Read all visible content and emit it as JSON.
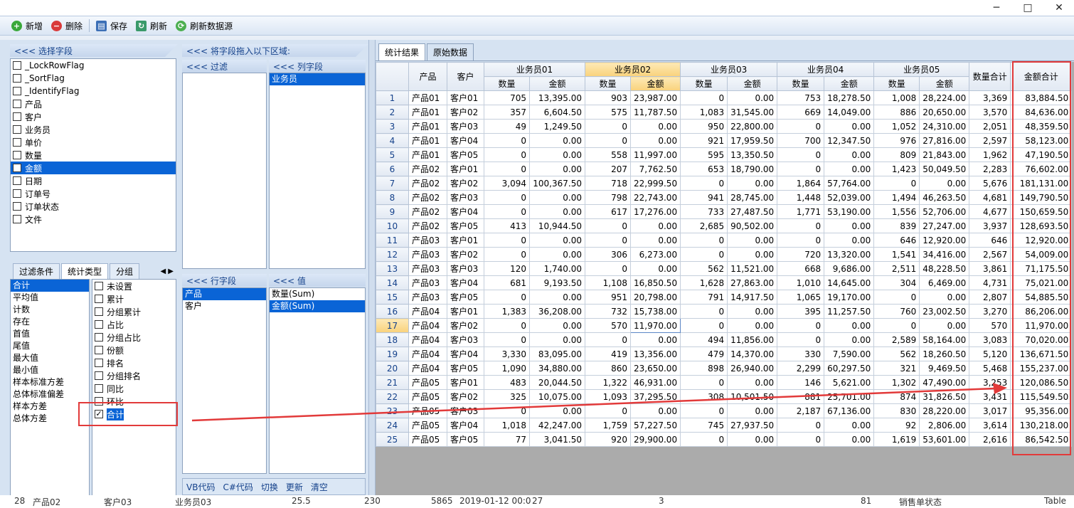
{
  "window": {
    "minimize": "─",
    "maximize": "□",
    "close": "✕"
  },
  "toolbar": {
    "add": "新增",
    "delete": "删除",
    "save": "保存",
    "refresh": "刷新",
    "refresh_source": "刷新数据源"
  },
  "left": {
    "select_field_header": "<<< 选择字段",
    "drag_header": "<<< 将字段拖入以下区域:",
    "filter_header": "<<< 过滤",
    "column_header": "<<< 列字段",
    "row_header": "<<< 行字段",
    "value_header": "<<< 值",
    "fields": [
      "_LockRowFlag",
      "_SortFlag",
      "_IdentifyFlag",
      "产品",
      "客户",
      "业务员",
      "单价",
      "数量",
      "金额",
      "日期",
      "订单号",
      "订单状态",
      "文件"
    ],
    "selected_field": "金额",
    "column_fields": [
      "业务员"
    ],
    "row_fields": [
      "产品",
      "客户"
    ],
    "value_fields": [
      "数量(Sum)",
      "金额(Sum)"
    ],
    "tabs": [
      "过滤条件",
      "统计类型",
      "分组"
    ],
    "tab_arrows": "◀ ▶",
    "stat_types": [
      "合计",
      "平均值",
      "计数",
      "存在",
      "首值",
      "尾值",
      "最大值",
      "最小值",
      "样本标准方差",
      "总体标准偏差",
      "样本方差",
      "总体方差"
    ],
    "options": [
      "未设置",
      "累计",
      "分组累计",
      "占比",
      "分组占比",
      "份额",
      "排名",
      "分组排名",
      "同比",
      "环比",
      "合计"
    ],
    "option_checked": "合计",
    "code_buttons": [
      "VB代码",
      "C#代码",
      "切换",
      "更新",
      "清空"
    ]
  },
  "right": {
    "tabs": [
      "统计结果",
      "原始数据"
    ],
    "header": {
      "product": "产品",
      "customer": "客户",
      "reps": [
        "业务员01",
        "业务员02",
        "业务员03",
        "业务员04",
        "业务员05"
      ],
      "qty": "数量",
      "amt": "金额",
      "qty_total": "数量合计",
      "amt_total": "金额合计"
    },
    "rows": [
      [
        "1",
        "产品01",
        "客户01",
        "705",
        "13,395.00",
        "903",
        "23,987.00",
        "0",
        "0.00",
        "753",
        "18,278.50",
        "1,008",
        "28,224.00",
        "3,369",
        "83,884.50"
      ],
      [
        "2",
        "产品01",
        "客户02",
        "357",
        "6,604.50",
        "575",
        "11,787.50",
        "1,083",
        "31,545.00",
        "669",
        "14,049.00",
        "886",
        "20,650.00",
        "3,570",
        "84,636.00"
      ],
      [
        "3",
        "产品01",
        "客户03",
        "49",
        "1,249.50",
        "0",
        "0.00",
        "950",
        "22,800.00",
        "0",
        "0.00",
        "1,052",
        "24,310.00",
        "2,051",
        "48,359.50"
      ],
      [
        "4",
        "产品01",
        "客户04",
        "0",
        "0.00",
        "0",
        "0.00",
        "921",
        "17,959.50",
        "700",
        "12,347.50",
        "976",
        "27,816.00",
        "2,597",
        "58,123.00"
      ],
      [
        "5",
        "产品01",
        "客户05",
        "0",
        "0.00",
        "558",
        "11,997.00",
        "595",
        "13,350.50",
        "0",
        "0.00",
        "809",
        "21,843.00",
        "1,962",
        "47,190.50"
      ],
      [
        "6",
        "产品02",
        "客户01",
        "0",
        "0.00",
        "207",
        "7,762.50",
        "653",
        "18,790.00",
        "0",
        "0.00",
        "1,423",
        "50,049.50",
        "2,283",
        "76,602.00"
      ],
      [
        "7",
        "产品02",
        "客户02",
        "3,094",
        "100,367.50",
        "718",
        "22,999.50",
        "0",
        "0.00",
        "1,864",
        "57,764.00",
        "0",
        "0.00",
        "5,676",
        "181,131.00"
      ],
      [
        "8",
        "产品02",
        "客户03",
        "0",
        "0.00",
        "798",
        "22,743.00",
        "941",
        "28,745.00",
        "1,448",
        "52,039.00",
        "1,494",
        "46,263.50",
        "4,681",
        "149,790.50"
      ],
      [
        "9",
        "产品02",
        "客户04",
        "0",
        "0.00",
        "617",
        "17,276.00",
        "733",
        "27,487.50",
        "1,771",
        "53,190.00",
        "1,556",
        "52,706.00",
        "4,677",
        "150,659.50"
      ],
      [
        "10",
        "产品02",
        "客户05",
        "413",
        "10,944.50",
        "0",
        "0.00",
        "2,685",
        "90,502.00",
        "0",
        "0.00",
        "839",
        "27,247.00",
        "3,937",
        "128,693.50"
      ],
      [
        "11",
        "产品03",
        "客户01",
        "0",
        "0.00",
        "0",
        "0.00",
        "0",
        "0.00",
        "0",
        "0.00",
        "646",
        "12,920.00",
        "646",
        "12,920.00"
      ],
      [
        "12",
        "产品03",
        "客户02",
        "0",
        "0.00",
        "306",
        "6,273.00",
        "0",
        "0.00",
        "720",
        "13,320.00",
        "1,541",
        "34,416.00",
        "2,567",
        "54,009.00"
      ],
      [
        "13",
        "产品03",
        "客户03",
        "120",
        "1,740.00",
        "0",
        "0.00",
        "562",
        "11,521.00",
        "668",
        "9,686.00",
        "2,511",
        "48,228.50",
        "3,861",
        "71,175.50"
      ],
      [
        "14",
        "产品03",
        "客户04",
        "681",
        "9,193.50",
        "1,108",
        "16,850.50",
        "1,628",
        "27,863.00",
        "1,010",
        "14,645.00",
        "304",
        "6,469.00",
        "4,731",
        "75,021.00"
      ],
      [
        "15",
        "产品03",
        "客户05",
        "0",
        "0.00",
        "951",
        "20,798.00",
        "791",
        "14,917.50",
        "1,065",
        "19,170.00",
        "0",
        "0.00",
        "2,807",
        "54,885.50"
      ],
      [
        "16",
        "产品04",
        "客户01",
        "1,383",
        "36,208.00",
        "732",
        "15,738.00",
        "0",
        "0.00",
        "395",
        "11,257.50",
        "760",
        "23,002.50",
        "3,270",
        "86,206.00"
      ],
      [
        "17",
        "产品04",
        "客户02",
        "0",
        "0.00",
        "570",
        "11,970.00",
        "0",
        "0.00",
        "0",
        "0.00",
        "0",
        "0.00",
        "570",
        "11,970.00"
      ],
      [
        "18",
        "产品04",
        "客户03",
        "0",
        "0.00",
        "0",
        "0.00",
        "494",
        "11,856.00",
        "0",
        "0.00",
        "2,589",
        "58,164.00",
        "3,083",
        "70,020.00"
      ],
      [
        "19",
        "产品04",
        "客户04",
        "3,330",
        "83,095.00",
        "419",
        "13,356.00",
        "479",
        "14,370.00",
        "330",
        "7,590.00",
        "562",
        "18,260.50",
        "5,120",
        "136,671.50"
      ],
      [
        "20",
        "产品04",
        "客户05",
        "1,090",
        "34,880.00",
        "860",
        "23,650.00",
        "898",
        "26,940.00",
        "2,299",
        "60,297.50",
        "321",
        "9,469.50",
        "5,468",
        "155,237.00"
      ],
      [
        "21",
        "产品05",
        "客户01",
        "483",
        "20,044.50",
        "1,322",
        "46,931.00",
        "0",
        "0.00",
        "146",
        "5,621.00",
        "1,302",
        "47,490.00",
        "3,253",
        "120,086.50"
      ],
      [
        "22",
        "产品05",
        "客户02",
        "325",
        "10,075.00",
        "1,093",
        "37,295.50",
        "308",
        "10,501.50",
        "881",
        "25,701.00",
        "874",
        "31,826.50",
        "3,431",
        "115,549.50"
      ],
      [
        "23",
        "产品05",
        "客户03",
        "0",
        "0.00",
        "0",
        "0.00",
        "0",
        "0.00",
        "2,187",
        "67,136.00",
        "830",
        "28,220.00",
        "3,017",
        "95,356.00"
      ],
      [
        "24",
        "产品05",
        "客户04",
        "1,018",
        "42,247.00",
        "1,759",
        "57,227.50",
        "745",
        "27,937.50",
        "0",
        "0.00",
        "92",
        "2,806.00",
        "3,614",
        "130,218.00"
      ],
      [
        "25",
        "产品05",
        "客户05",
        "77",
        "3,041.50",
        "920",
        "29,900.00",
        "0",
        "0.00",
        "0",
        "0.00",
        "1,619",
        "53,601.00",
        "2,616",
        "86,542.50"
      ]
    ]
  },
  "bottom": [
    "28",
    "产品02",
    "客户03",
    "业务员03",
    "25.5",
    "230",
    "5865",
    "2019-01-12 00:0",
    "27",
    "3",
    "81",
    "销售单状态",
    "Table"
  ],
  "colors": {
    "selection": "#0a64d6",
    "header_highlight": "#f9d27c",
    "annotation": "#e23a3a"
  }
}
